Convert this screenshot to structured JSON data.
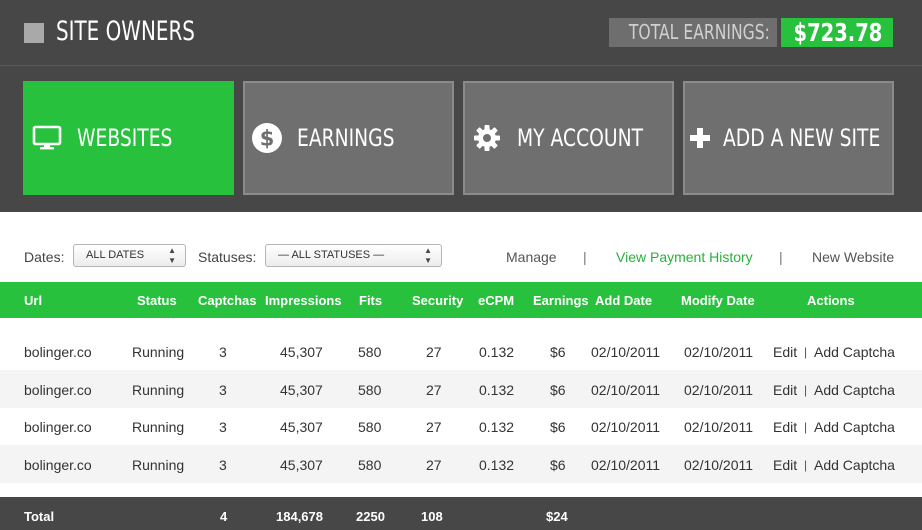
{
  "header": {
    "title": "SITE OWNERS",
    "earnings_label": "TOTAL EARNINGS:",
    "earnings_value": "$723.78"
  },
  "nav": {
    "items": [
      {
        "label": "WEBSITES",
        "icon": "monitor-icon",
        "active": true
      },
      {
        "label": "EARNINGS",
        "icon": "dollar-icon",
        "active": false
      },
      {
        "label": "MY ACCOUNT",
        "icon": "gear-icon",
        "active": false
      },
      {
        "label": "ADD A NEW SITE",
        "icon": "plus-icon",
        "active": false
      }
    ]
  },
  "filters": {
    "dates_label": "Dates:",
    "dates_value": "ALL DATES",
    "statuses_label": "Statuses:",
    "statuses_value": "— ALL STATUSES —",
    "links": {
      "manage": "Manage",
      "separator": "|",
      "payment_history": "View Payment History",
      "new_website": "New Website"
    }
  },
  "table": {
    "columns": [
      "Url",
      "Status",
      "Captchas",
      "Impressions",
      "Fits",
      "Security",
      "eCPM",
      "Earnings",
      "Add Date",
      "Modify Date",
      "Actions"
    ],
    "rows": [
      {
        "url": "bolinger.co",
        "status": "Running",
        "captchas": "3",
        "impressions": "45,307",
        "fits": "580",
        "security": "27",
        "ecpm": "0.132",
        "earnings": "$6",
        "add_date": "02/10/2011",
        "modify_date": "02/10/2011",
        "edit": "Edit",
        "sep": "|",
        "add_captcha": "Add Captcha"
      },
      {
        "url": "bolinger.co",
        "status": "Running",
        "captchas": "3",
        "impressions": "45,307",
        "fits": "580",
        "security": "27",
        "ecpm": "0.132",
        "earnings": "$6",
        "add_date": "02/10/2011",
        "modify_date": "02/10/2011",
        "edit": "Edit",
        "sep": "|",
        "add_captcha": "Add Captcha"
      },
      {
        "url": "bolinger.co",
        "status": "Running",
        "captchas": "3",
        "impressions": "45,307",
        "fits": "580",
        "security": "27",
        "ecpm": "0.132",
        "earnings": "$6",
        "add_date": "02/10/2011",
        "modify_date": "02/10/2011",
        "edit": "Edit",
        "sep": "|",
        "add_captcha": "Add Captcha"
      },
      {
        "url": "bolinger.co",
        "status": "Running",
        "captchas": "3",
        "impressions": "45,307",
        "fits": "580",
        "security": "27",
        "ecpm": "0.132",
        "earnings": "$6",
        "add_date": "02/10/2011",
        "modify_date": "02/10/2011",
        "edit": "Edit",
        "sep": "|",
        "add_captcha": "Add Captcha"
      }
    ],
    "totals": {
      "label": "Total",
      "captchas": "4",
      "impressions": "184,678",
      "fits": "2250",
      "security": "108",
      "earnings": "$24"
    }
  },
  "colors": {
    "accent": "#28c13d",
    "header_bg": "#474747",
    "tile_bg": "#6f6f6f"
  }
}
